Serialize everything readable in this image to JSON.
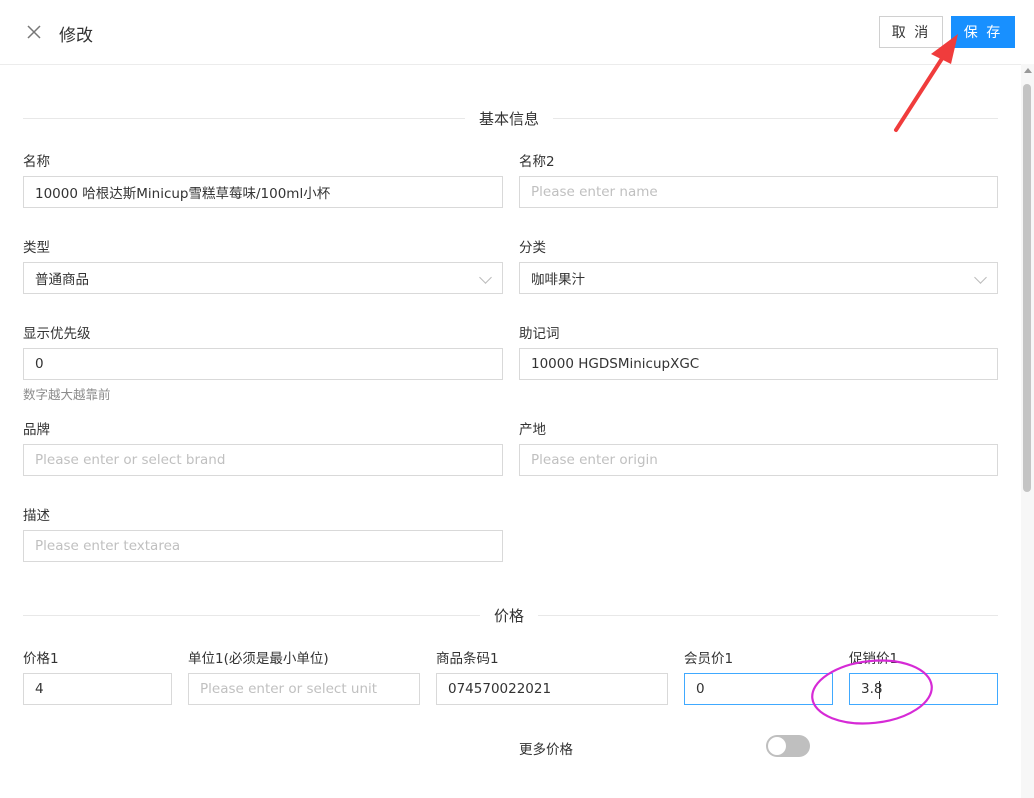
{
  "header": {
    "title": "修改",
    "cancel_label": "取 消",
    "save_label": "保 存"
  },
  "sections": {
    "basic": "基本信息",
    "price": "价格"
  },
  "basic": {
    "name": {
      "label": "名称",
      "value": "10000 哈根达斯Minicup雪糕草莓味/100ml小杯"
    },
    "name2": {
      "label": "名称2",
      "placeholder": "Please enter name"
    },
    "type": {
      "label": "类型",
      "value": "普通商品"
    },
    "category": {
      "label": "分类",
      "value": "咖啡果汁"
    },
    "priority": {
      "label": "显示优先级",
      "value": "0",
      "hint": "数字越大越靠前"
    },
    "mnemonic": {
      "label": "助记词",
      "value": "10000 HGDSMinicupXGC"
    },
    "brand": {
      "label": "品牌",
      "placeholder": "Please enter or select brand"
    },
    "origin": {
      "label": "产地",
      "placeholder": "Please enter origin"
    },
    "description": {
      "label": "描述",
      "placeholder": "Please enter textarea"
    }
  },
  "price": {
    "price1": {
      "label": "价格1",
      "value": "4"
    },
    "unit1": {
      "label": "单位1(必须是最小单位)",
      "placeholder": "Please enter or select unit"
    },
    "barcode1": {
      "label": "商品条码1",
      "value": "074570022021"
    },
    "member_price1": {
      "label": "会员价1",
      "value": "0"
    },
    "promo_price1": {
      "label": "促销价1",
      "value": "3.8"
    },
    "more_prices": {
      "label": "更多价格",
      "enabled": false
    }
  },
  "colors": {
    "accent": "#1890ff",
    "annotation_arrow": "#f03c3c",
    "annotation_circle": "#d62ad6"
  }
}
